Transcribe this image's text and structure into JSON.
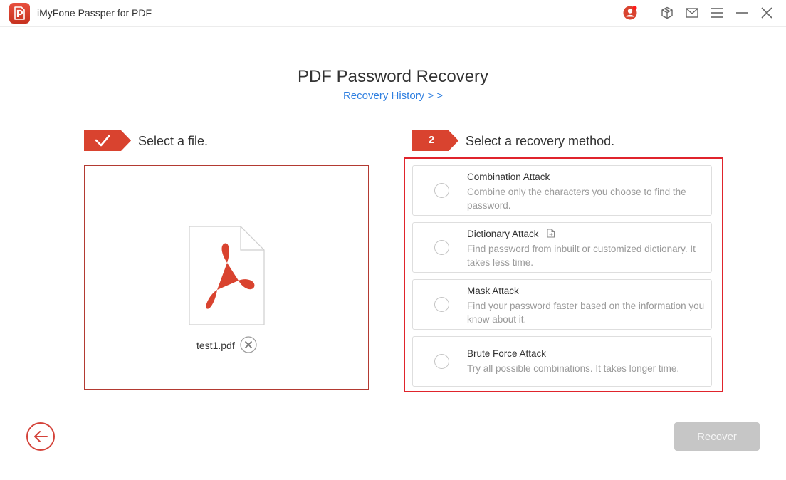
{
  "app": {
    "title": "iMyFone Passper for PDF",
    "logo_icon": "passper-pdf-logo-icon",
    "accent_color": "#d9432f",
    "highlight_border_color": "#e0242c"
  },
  "titlebar": {
    "icons": [
      {
        "name": "account-icon",
        "has_notification_dot": true
      },
      {
        "name": "package-icon"
      },
      {
        "name": "mail-icon"
      },
      {
        "name": "menu-icon"
      },
      {
        "name": "minimize-icon"
      },
      {
        "name": "close-icon"
      }
    ]
  },
  "header": {
    "title": "PDF Password Recovery",
    "history_link": "Recovery History > >"
  },
  "steps": [
    {
      "badge": "✓",
      "badge_icon": "checkmark-icon",
      "label": "Select a file.",
      "completed": true
    },
    {
      "badge": "2",
      "label": "Select a recovery method.",
      "completed": false
    }
  ],
  "file": {
    "name": "test1.pdf",
    "icon": "pdf-file-icon",
    "remove_icon": "remove-file-icon"
  },
  "methods": [
    {
      "title": "Combination Attack",
      "description": "Combine only the characters you choose to find the password.",
      "selected": false,
      "has_dictionary_icon": false
    },
    {
      "title": "Dictionary Attack",
      "description": "Find password from inbuilt or customized dictionary. It takes less time.",
      "selected": false,
      "has_dictionary_icon": true
    },
    {
      "title": "Mask Attack",
      "description": "Find your password faster based on the information you know about it.",
      "selected": false,
      "has_dictionary_icon": false
    },
    {
      "title": "Brute Force Attack",
      "description": "Try all possible combinations. It takes longer time.",
      "selected": false,
      "has_dictionary_icon": false
    }
  ],
  "footer": {
    "back_icon": "back-arrow-icon",
    "recover_label": "Recover",
    "recover_enabled": false
  }
}
